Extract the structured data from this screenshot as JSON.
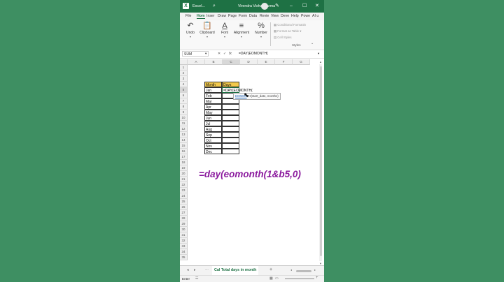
{
  "titlebar": {
    "app_title": "Excel...",
    "user_name": "Virendra Vishwakarma"
  },
  "tabs": [
    "File",
    "Hom",
    "Inser",
    "Draw",
    "Page",
    "Form",
    "Data",
    "Revie",
    "View",
    "Deve",
    "Help",
    "Powe",
    "AI u"
  ],
  "ribbon": {
    "undo": "Undo",
    "clipboard": "Clipboard",
    "font": "Font",
    "alignment": "Alignment",
    "number": "Number",
    "conditional_formatting": "Conditional Formattin",
    "format_as_table": "Format as Table",
    "cell_styles": "Cell Styles",
    "styles_group": "Styles"
  },
  "formula_bar": {
    "name_box": "SUM",
    "cancel": "✕",
    "enter": "✓",
    "fx": "fx",
    "formula": "=DAY(EOMONTH("
  },
  "columns": [
    "A",
    "B",
    "C",
    "D",
    "E",
    "F",
    "G"
  ],
  "rows": [
    "1",
    "2",
    "3",
    "4",
    "5",
    "6",
    "7",
    "8",
    "9",
    "10",
    "11",
    "12",
    "13",
    "14",
    "15",
    "16",
    "17",
    "18",
    "19",
    "20",
    "21",
    "22",
    "23",
    "24",
    "25",
    "26",
    "27",
    "28",
    "29",
    "30",
    "31",
    "32",
    "33",
    "34",
    "35"
  ],
  "table": {
    "header_month": "Month",
    "header_days": "Days",
    "months": [
      "Jan",
      "Feb",
      "Mar",
      "Apr",
      "May",
      "Jun",
      "Jul",
      "Aug",
      "Sep",
      "Oct",
      "Nov",
      "Dec"
    ],
    "active_cell_text": "=DAY(EOMONTH("
  },
  "tooltip": {
    "func": "EOMON",
    "args": "TH(start_date, months)"
  },
  "overlay_text": "=day(eomonth(1&b5,0)",
  "sheet_tab": "Cal Total days in month",
  "status": "Enter",
  "colors": {
    "background": "#3e8f62",
    "titlebar": "#1e7144",
    "header_fill": "#f2c94c",
    "overlay_text": "#8b1a9e"
  }
}
